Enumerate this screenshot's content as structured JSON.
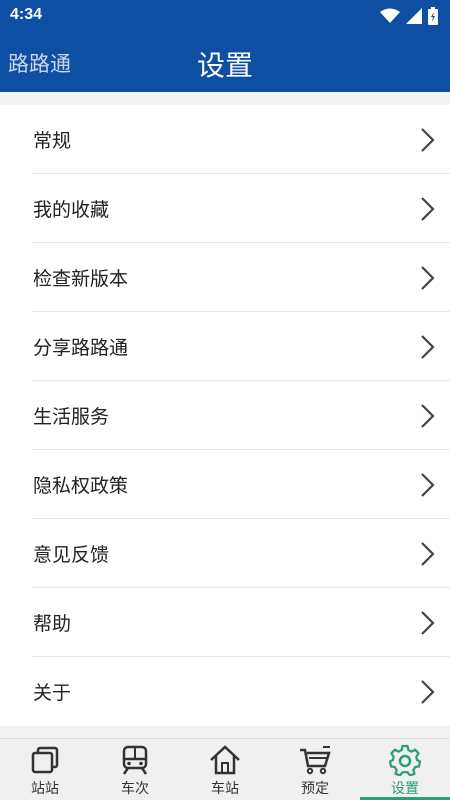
{
  "status_bar": {
    "time": "4:34"
  },
  "header": {
    "brand": "路路通",
    "title": "设置"
  },
  "menu": {
    "items": [
      {
        "label": "常规"
      },
      {
        "label": "我的收藏"
      },
      {
        "label": "检查新版本"
      },
      {
        "label": "分享路路通"
      },
      {
        "label": "生活服务"
      },
      {
        "label": "隐私权政策"
      },
      {
        "label": "意见反馈"
      },
      {
        "label": "帮助"
      },
      {
        "label": "关于"
      }
    ]
  },
  "tabs": [
    {
      "label": "站站",
      "icon": "stations-icon"
    },
    {
      "label": "车次",
      "icon": "train-icon"
    },
    {
      "label": "车站",
      "icon": "home-icon"
    },
    {
      "label": "预定",
      "icon": "cart-icon"
    },
    {
      "label": "设置",
      "icon": "gear-icon",
      "active": true
    }
  ],
  "colors": {
    "primary": "#0f4fa3",
    "accent": "#2a9d7a"
  }
}
